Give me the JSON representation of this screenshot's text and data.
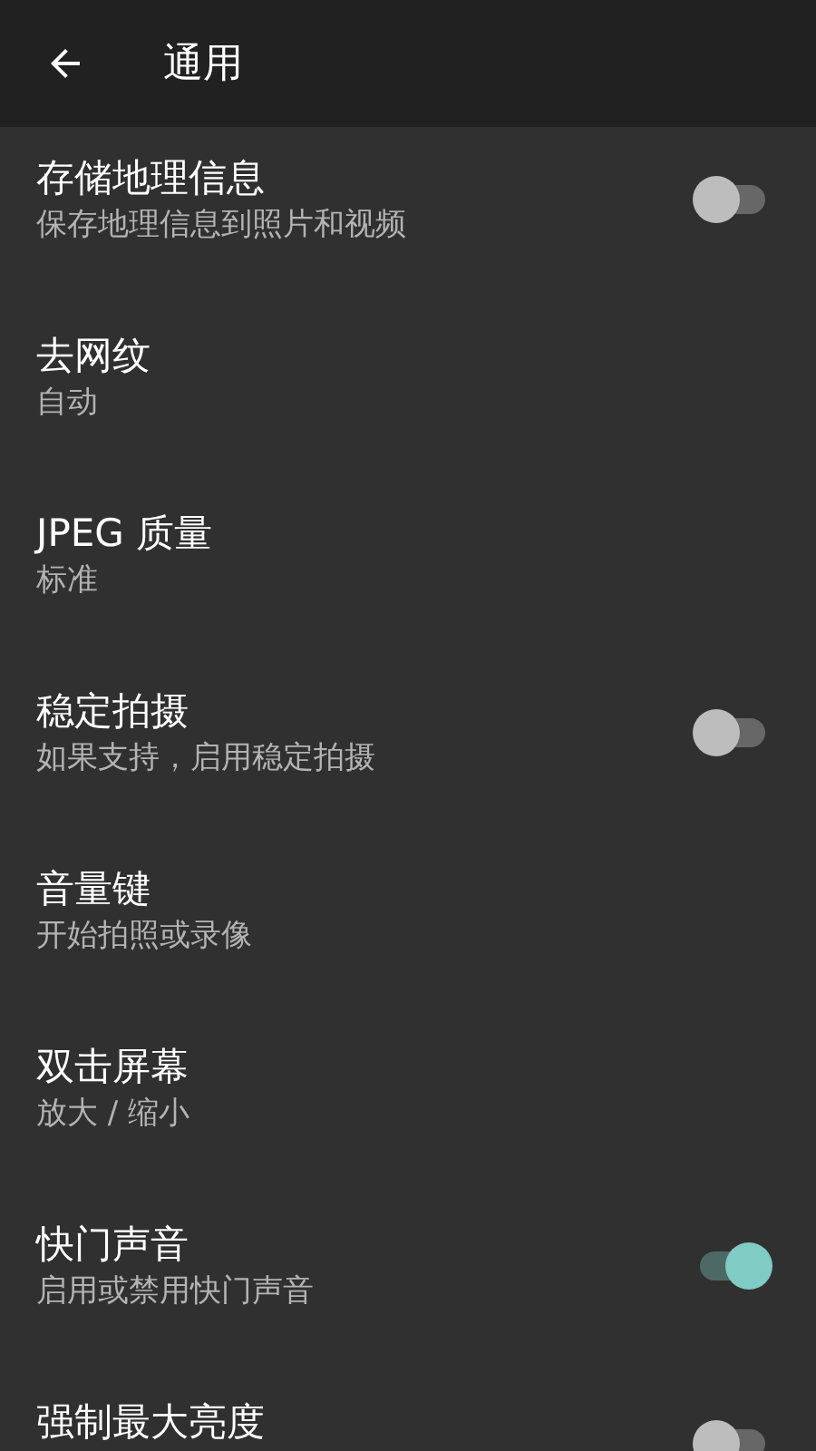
{
  "app_bar": {
    "title": "通用"
  },
  "settings": [
    {
      "kind": "switch",
      "title": "存储地理信息",
      "subtitle": "保存地理信息到照片和视频",
      "on": false
    },
    {
      "kind": "text",
      "title": "去网纹",
      "subtitle": "自动"
    },
    {
      "kind": "text",
      "title": "JPEG 质量",
      "subtitle": "标准"
    },
    {
      "kind": "switch",
      "title": "稳定拍摄",
      "subtitle": "如果支持，启用稳定拍摄",
      "on": false
    },
    {
      "kind": "text",
      "title": "音量键",
      "subtitle": "开始拍照或录像"
    },
    {
      "kind": "text",
      "title": "双击屏幕",
      "subtitle": "放大 / 缩小"
    },
    {
      "kind": "switch",
      "title": "快门声音",
      "subtitle": "启用或禁用快门声音",
      "on": true
    },
    {
      "kind": "switch",
      "title": "强制最大亮度",
      "on": false
    }
  ]
}
